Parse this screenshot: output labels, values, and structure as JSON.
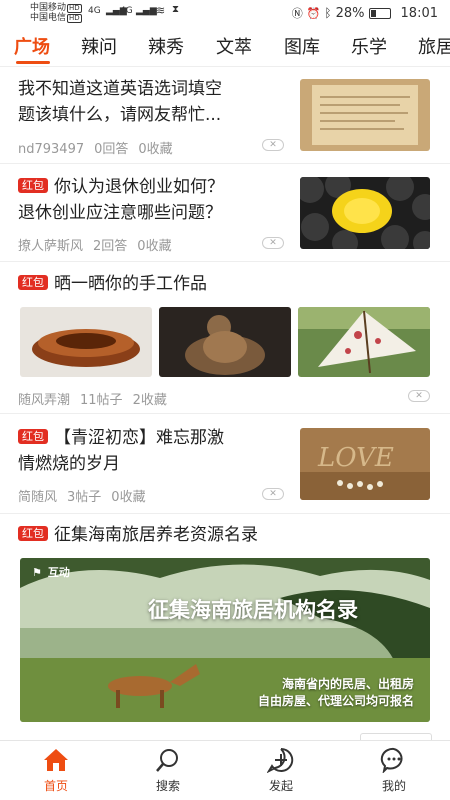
{
  "status_bar": {
    "carrier1": "中国移动",
    "carrier2": "中国电信",
    "hd": "HD",
    "net1": "4G",
    "net2": "4G",
    "battery": "28%",
    "time": "18:01"
  },
  "tabs": [
    "广场",
    "辣问",
    "辣秀",
    "文萃",
    "图库",
    "乐学",
    "旅居"
  ],
  "red_badge": "红包",
  "feed": [
    {
      "title_l1": "我不知道这道英语选词填空",
      "title_l2": "题该填什么，请网友帮忙...",
      "author": "nd793497",
      "stat1": "0回答",
      "stat2": "0收藏"
    },
    {
      "title_l1": "你认为退休创业如何？",
      "title_l2": "退休创业应注意哪些问题？",
      "author": "撩人萨斯风",
      "stat1": "2回答",
      "stat2": "0收藏"
    },
    {
      "title_l1": "晒一晒你的手工作品",
      "author": "随风弄潮",
      "stat1": "11帖子",
      "stat2": "2收藏"
    },
    {
      "title_l1": "【青涩初恋】难忘那激",
      "title_l2": "情燃烧的岁月",
      "author": "简随风",
      "stat1": "3帖子",
      "stat2": "0收藏"
    },
    {
      "title_l1": "征集海南旅居养老资源名录",
      "banner_title": "征集海南旅居机构名录",
      "banner_sub1": "海南省内的民居、出租房",
      "banner_sub2": "自由房屋、代理公司均可报名",
      "banner_logo": "互动"
    }
  ],
  "nav": [
    "首页",
    "搜索",
    "发起",
    "我的"
  ],
  "colors": {
    "accent": "#ee4d12",
    "badge": "#e22e22"
  }
}
